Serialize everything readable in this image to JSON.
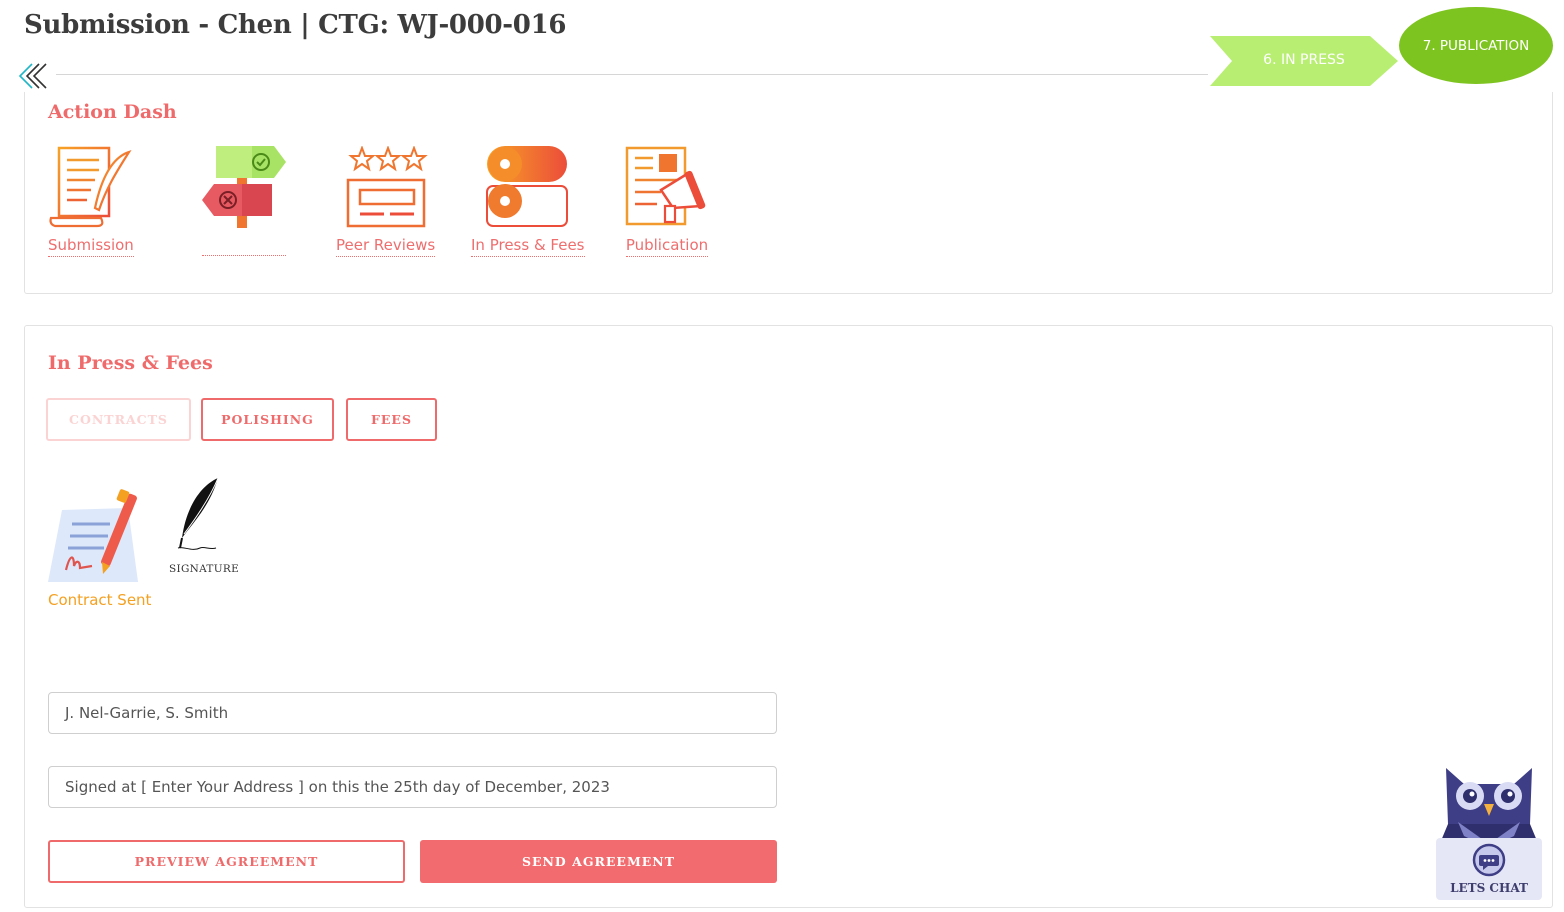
{
  "header": {
    "title": "Submission - Chen | CTG: WJ-000-016"
  },
  "stages": {
    "in_press": "6. IN PRESS",
    "publication": "7. PUBLICATION"
  },
  "action_dash": {
    "title": "Action Dash",
    "items": [
      {
        "label": "Submission",
        "icon": "manuscript-quill-icon"
      },
      {
        "label": "",
        "icon": "decision-signpost-icon"
      },
      {
        "label": "Peer Reviews",
        "icon": "star-review-icon"
      },
      {
        "label": "In Press & Fees",
        "icon": "press-rolls-icon"
      },
      {
        "label": "Publication",
        "icon": "publication-megaphone-icon"
      }
    ]
  },
  "in_press": {
    "title": "In Press & Fees",
    "tabs": [
      "CONTRACTS",
      "POLISHING",
      "FEES"
    ],
    "contract_label": "Contract Sent",
    "signature_label": "SIGNATURE",
    "author_field": "J. Nel-Garrie, S. Smith",
    "signed_field": "Signed at [ Enter Your Address ] on this the 25th day of December, 2023",
    "preview_button": "PREVIEW AGREEMENT",
    "send_button": "SEND AGREEMENT"
  },
  "chat": {
    "label": "LETS CHAT"
  },
  "colors": {
    "accent": "#ef6b6b",
    "stage_in_press": "#b8ee72",
    "stage_publication": "#7ec420",
    "contract_label": "#f4a021"
  }
}
